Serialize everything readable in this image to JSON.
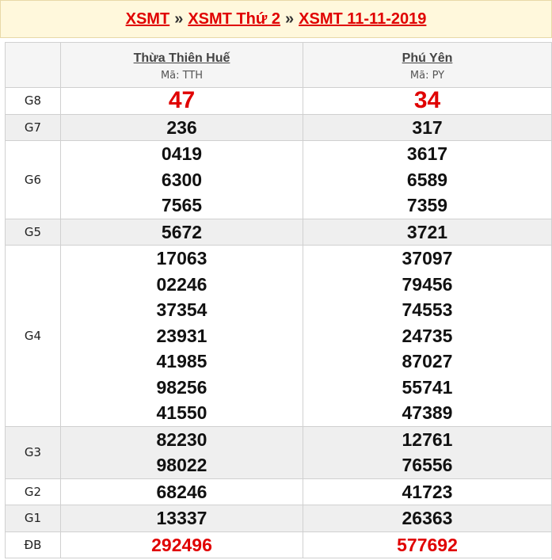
{
  "breadcrumb": {
    "items": [
      "XSMT",
      "XSMT Thứ 2",
      "XSMT 11-11-2019"
    ],
    "separator": "»",
    "link_color": "#e00000"
  },
  "provinces": [
    {
      "name": "Thừa Thiên Huế",
      "code": "Mã: TTH"
    },
    {
      "name": "Phú Yên",
      "code": "Mã: PY"
    }
  ],
  "prizes": [
    {
      "label": "G8",
      "values": [
        [
          "47"
        ],
        [
          "34"
        ]
      ]
    },
    {
      "label": "G7",
      "values": [
        [
          "236"
        ],
        [
          "317"
        ]
      ]
    },
    {
      "label": "G6",
      "values": [
        [
          "0419",
          "6300",
          "7565"
        ],
        [
          "3617",
          "6589",
          "7359"
        ]
      ]
    },
    {
      "label": "G5",
      "values": [
        [
          "5672"
        ],
        [
          "3721"
        ]
      ]
    },
    {
      "label": "G4",
      "values": [
        [
          "17063",
          "02246",
          "37354",
          "23931",
          "41985",
          "98256",
          "41550"
        ],
        [
          "37097",
          "79456",
          "74553",
          "24735",
          "87027",
          "55741",
          "47389"
        ]
      ]
    },
    {
      "label": "G3",
      "values": [
        [
          "82230",
          "98022"
        ],
        [
          "12761",
          "76556"
        ]
      ]
    },
    {
      "label": "G2",
      "values": [
        [
          "68246"
        ],
        [
          "41723"
        ]
      ]
    },
    {
      "label": "G1",
      "values": [
        [
          "13337"
        ],
        [
          "26363"
        ]
      ]
    },
    {
      "label": "ĐB",
      "values": [
        [
          "292496"
        ],
        [
          "577692"
        ]
      ]
    }
  ]
}
